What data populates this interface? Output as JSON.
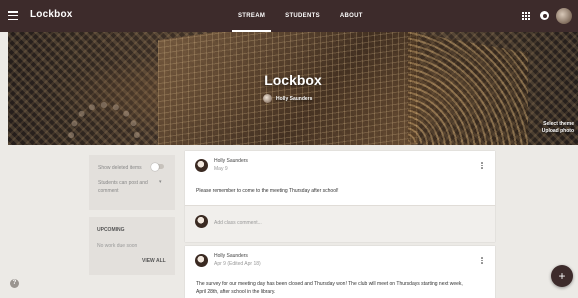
{
  "app": {
    "title": "Lockbox"
  },
  "nav": {
    "tabs": [
      {
        "label": "STREAM",
        "active": true
      },
      {
        "label": "STUDENTS",
        "active": false
      },
      {
        "label": "ABOUT",
        "active": false
      }
    ]
  },
  "topbar_icons": [
    "menu-icon",
    "apps-icon",
    "notifications-icon",
    "account-avatar"
  ],
  "banner": {
    "class_title": "Lockbox",
    "teacher_name": "Holly Saunders",
    "select_theme": "Select theme",
    "upload_photo": "Upload photo"
  },
  "sidebar": {
    "show_deleted": "Show deleted items",
    "students_can": "Students can post and",
    "students_can_2": "comment",
    "upcoming_title": "UPCOMING",
    "no_work": "No work due soon",
    "view_all": "VIEW ALL"
  },
  "posts": [
    {
      "author": "Holly Saunders",
      "date": "May 9",
      "body": "Please remember to come to the meeting Thursday after school!",
      "comment_placeholder": "Add class comment..."
    },
    {
      "author": "Holly Saunders",
      "date": "Apr 9 (Edited Apr 18)",
      "body_line1": "The survey for our meeting day has been closed and Thursday won! The club will meet on Thursdays starting next week,",
      "body_line2": "April 28th, after school in the library."
    }
  ],
  "fab_label": "+",
  "help_label": "?",
  "colors": {
    "primary": "#3d2b2b",
    "background": "#eceae6"
  }
}
